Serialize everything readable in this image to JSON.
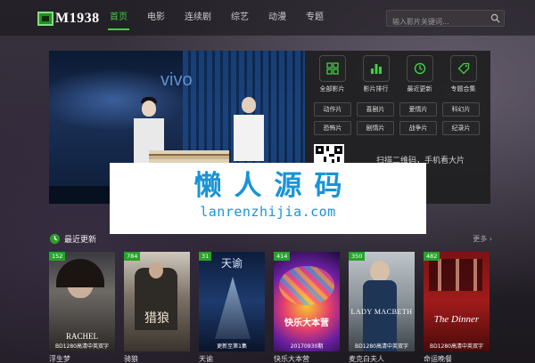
{
  "header": {
    "logo_text": "M1938",
    "nav": [
      "首页",
      "电影",
      "连续剧",
      "综艺",
      "动漫",
      "专题"
    ],
    "search_placeholder": "输入影片关键词..."
  },
  "banner": {
    "brand_text": "vivo"
  },
  "quick_links": [
    {
      "label": "全部影片",
      "icon": "grid-icon"
    },
    {
      "label": "影片排行",
      "icon": "bar-chart-icon"
    },
    {
      "label": "最近更新",
      "icon": "clock-icon"
    },
    {
      "label": "专题合集",
      "icon": "tag-icon"
    }
  ],
  "genres": [
    "动作片",
    "喜剧片",
    "爱情片",
    "科幻片",
    "恐怖片",
    "剧情片",
    "战争片",
    "纪录片"
  ],
  "qr_text": "扫描二维码，手机看大片",
  "watermark": {
    "title": "懒人源码",
    "url": "lanrenzhijia.com"
  },
  "latest": {
    "title": "最近更新",
    "more": "更多",
    "items": [
      {
        "title": "浮生梦",
        "badge": "152",
        "art": "RACHEL",
        "sub": "BD1280高清中英双字"
      },
      {
        "title": "骑狼",
        "badge": "784",
        "art": "猎狼",
        "sub": ""
      },
      {
        "title": "天谕",
        "badge": "31",
        "art": "天谕",
        "sub": "更新至第1集"
      },
      {
        "title": "快乐大本营",
        "badge": "414",
        "art": "快乐大本营",
        "sub": "20170930期"
      },
      {
        "title": "麦克白夫人",
        "badge": "350",
        "art": "LADY MACBETH",
        "sub": "BD1280高清中英双字"
      },
      {
        "title": "命运晚餐",
        "badge": "482",
        "art": "The Dinner",
        "sub": "BD1280高清中英双字"
      }
    ]
  },
  "colors": {
    "accent": "#3fcf3f",
    "badge": "#27a327",
    "watermark_text": "#1894d8"
  }
}
